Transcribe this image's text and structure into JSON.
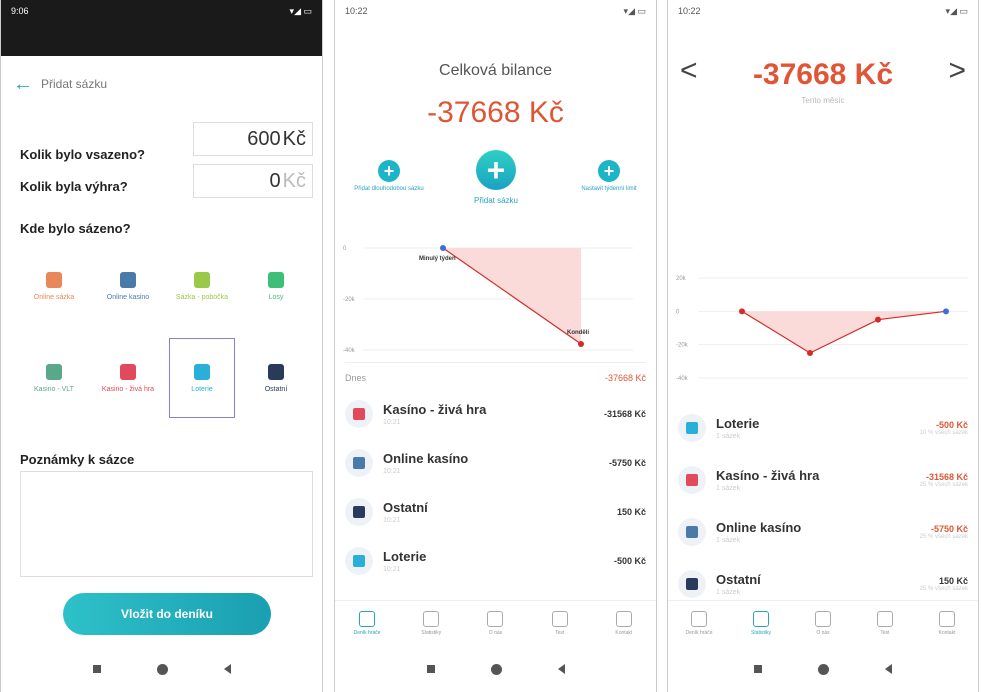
{
  "panel1": {
    "status_time": "9:06",
    "status_right": "▾◢ ▭",
    "title": "Přidat sázku",
    "q_staked": "Kolik bylo vsazeno?",
    "staked_value": "600",
    "staked_currency": "Kč",
    "q_won": "Kolik byla výhra?",
    "won_value": "0",
    "won_currency": "Kč",
    "q_where": "Kde bylo sázeno?",
    "categories": [
      {
        "label": "Online sázka",
        "color": "#e8875a"
      },
      {
        "label": "Online kasino",
        "color": "#4a7aa8"
      },
      {
        "label": "Sázka - pobočka",
        "color": "#9ac94a"
      },
      {
        "label": "Losy",
        "color": "#3dbf7a"
      },
      {
        "label": "Kasino - VLT",
        "color": "#5aa88a"
      },
      {
        "label": "Kasino - živá hra",
        "color": "#e04a5a"
      },
      {
        "label": "Loterie",
        "color": "#2ab0d8"
      },
      {
        "label": "Ostatní",
        "color": "#2a3a5a"
      }
    ],
    "selected_category": "Loterie",
    "notes_label": "Poznámky k sázce",
    "submit_label": "Vložit do deníku"
  },
  "panel2": {
    "status_time": "10:22",
    "status_right": "▾◢ ▭",
    "title": "Celková bilance",
    "balance": "-37668 Kč",
    "action_left": "Přidat dlouhodobou sázku",
    "action_center": "Přidat sázku",
    "action_right": "Nastavit týdenní limit",
    "chart_data": {
      "type": "line",
      "y_ticks": [
        "0",
        "-20k",
        "-40k"
      ],
      "points": [
        {
          "label": "Minulý týden",
          "y": 0
        },
        {
          "label": "Kondělí",
          "y": -37668
        }
      ],
      "ylim": [
        -40000,
        0
      ]
    },
    "today_label": "Dnes",
    "today_total": "-37668 Kč",
    "items": [
      {
        "name": "Kasíno - živá hra",
        "time": "10:21",
        "amount": "-31568 Kč",
        "color": "#e04a5a"
      },
      {
        "name": "Online kasíno",
        "time": "10:21",
        "amount": "-5750 Kč",
        "color": "#4a7aa8"
      },
      {
        "name": "Ostatní",
        "time": "10:21",
        "amount": "150 Kč",
        "color": "#2a3a5a"
      },
      {
        "name": "Loterie",
        "time": "10:21",
        "amount": "-500 Kč",
        "color": "#2ab0d8"
      }
    ]
  },
  "panel3": {
    "status_time": "10:22",
    "status_right": "▾◢ ▭",
    "prev": "<",
    "next": ">",
    "balance": "-37668 Kč",
    "subtitle": "Tento měsíc",
    "chart_data": {
      "type": "line",
      "y_ticks": [
        "20k",
        "0",
        "-20k",
        "-40k"
      ],
      "points": [
        {
          "y": 0
        },
        {
          "y": -25000
        },
        {
          "y": -5000
        },
        {
          "y": 0
        }
      ],
      "ylim": [
        -40000,
        20000
      ]
    },
    "items": [
      {
        "name": "Loterie",
        "sub": "1 sázek",
        "amount": "-500 Kč",
        "pct": "10 % všech sázek",
        "color": "#2ab0d8",
        "red": true
      },
      {
        "name": "Kasíno - živá hra",
        "sub": "1 sázek",
        "amount": "-31568 Kč",
        "pct": "25 % všech sázek",
        "color": "#e04a5a",
        "red": true
      },
      {
        "name": "Online kasíno",
        "sub": "1 sázek",
        "amount": "-5750 Kč",
        "pct": "25 % všech sázek",
        "color": "#4a7aa8",
        "red": true
      },
      {
        "name": "Ostatní",
        "sub": "1 sázek",
        "amount": "150 Kč",
        "pct": "25 % všech sázek",
        "color": "#2a3a5a",
        "red": false
      }
    ]
  },
  "tabs": [
    "Deník hráče",
    "Statistiky",
    "O nás",
    "Test",
    "Kontakt"
  ]
}
